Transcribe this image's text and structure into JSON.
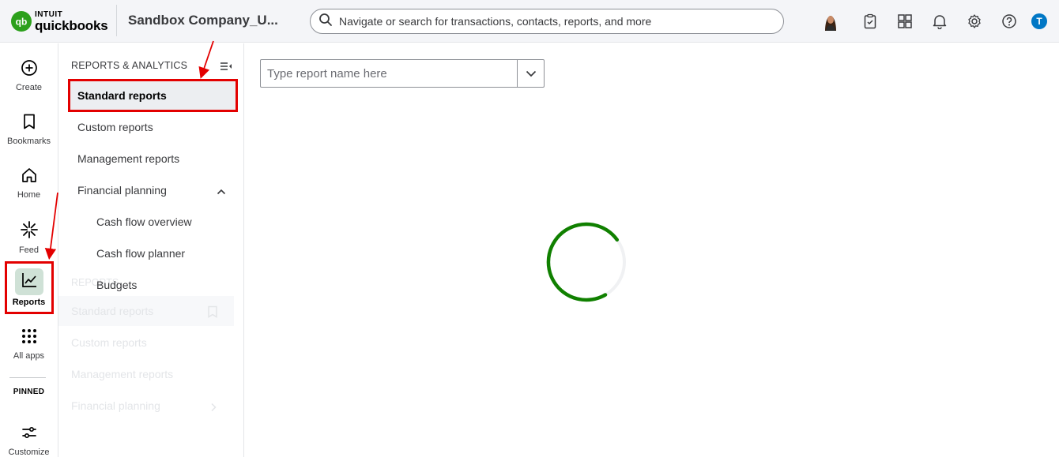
{
  "header": {
    "brand_top": "INTUIT",
    "brand_bottom": "quickbooks",
    "company_name": "Sandbox Company_U...",
    "search_placeholder": "Navigate or search for transactions, contacts, reports, and more",
    "icons": [
      "user-avatar",
      "tasks-icon",
      "apps-switcher-icon",
      "notifications-bell-icon",
      "settings-gear-icon",
      "help-icon",
      "user-initial-badge"
    ],
    "user_initial": "T"
  },
  "rail": {
    "items": [
      {
        "label": "Create",
        "icon": "plus-circle-icon"
      },
      {
        "label": "Bookmarks",
        "icon": "bookmark-icon"
      },
      {
        "label": "Home",
        "icon": "home-icon"
      },
      {
        "label": "Feed",
        "icon": "feed-sparkle-icon"
      },
      {
        "label": "Reports",
        "icon": "chart-line-icon",
        "active": true
      },
      {
        "label": "All apps",
        "icon": "grid-dots-icon"
      }
    ],
    "pinned_label": "PINNED",
    "customize_label": "Customize"
  },
  "panel": {
    "title": "REPORTS & ANALYTICS",
    "items": [
      {
        "label": "Standard reports",
        "active": true
      },
      {
        "label": "Custom reports"
      },
      {
        "label": "Management reports"
      },
      {
        "label": "Financial planning",
        "expanded": true
      }
    ],
    "sub_items": [
      {
        "label": "Cash flow overview"
      },
      {
        "label": "Cash flow planner"
      },
      {
        "label": "Budgets"
      }
    ],
    "ghost": {
      "title": "REPORTS",
      "items": [
        "Standard reports",
        "Custom reports",
        "Management reports",
        "Financial planning"
      ]
    }
  },
  "main": {
    "report_search_placeholder": "Type report name here",
    "loading": true
  },
  "colors": {
    "brand_green": "#2ca01c",
    "spinner_green": "#108000",
    "annotation_red": "#e30000",
    "active_rail_bg": "#cfe1d6",
    "user_badge_blue": "#0077c5"
  }
}
